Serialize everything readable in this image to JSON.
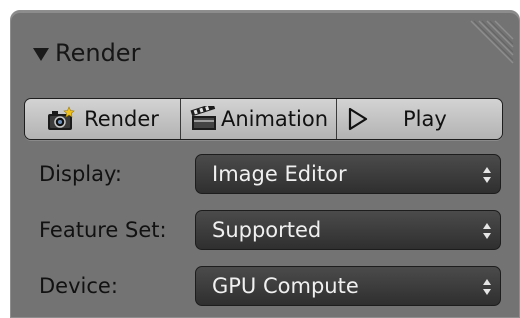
{
  "panel": {
    "title": "Render",
    "colors": {
      "panel_bg": "#737373",
      "button_bg": "#c4c4c4",
      "select_bg": "#3c3c3c"
    }
  },
  "buttons": {
    "render": {
      "label": "Render",
      "icon": "camera-icon"
    },
    "animation": {
      "label": "Animation",
      "icon": "clapperboard-icon"
    },
    "play": {
      "label": "Play",
      "icon": "play-icon"
    }
  },
  "fields": {
    "display": {
      "label": "Display:",
      "value": "Image Editor"
    },
    "feature_set": {
      "label": "Feature Set:",
      "value": "Supported"
    },
    "device": {
      "label": "Device:",
      "value": "GPU Compute"
    }
  }
}
